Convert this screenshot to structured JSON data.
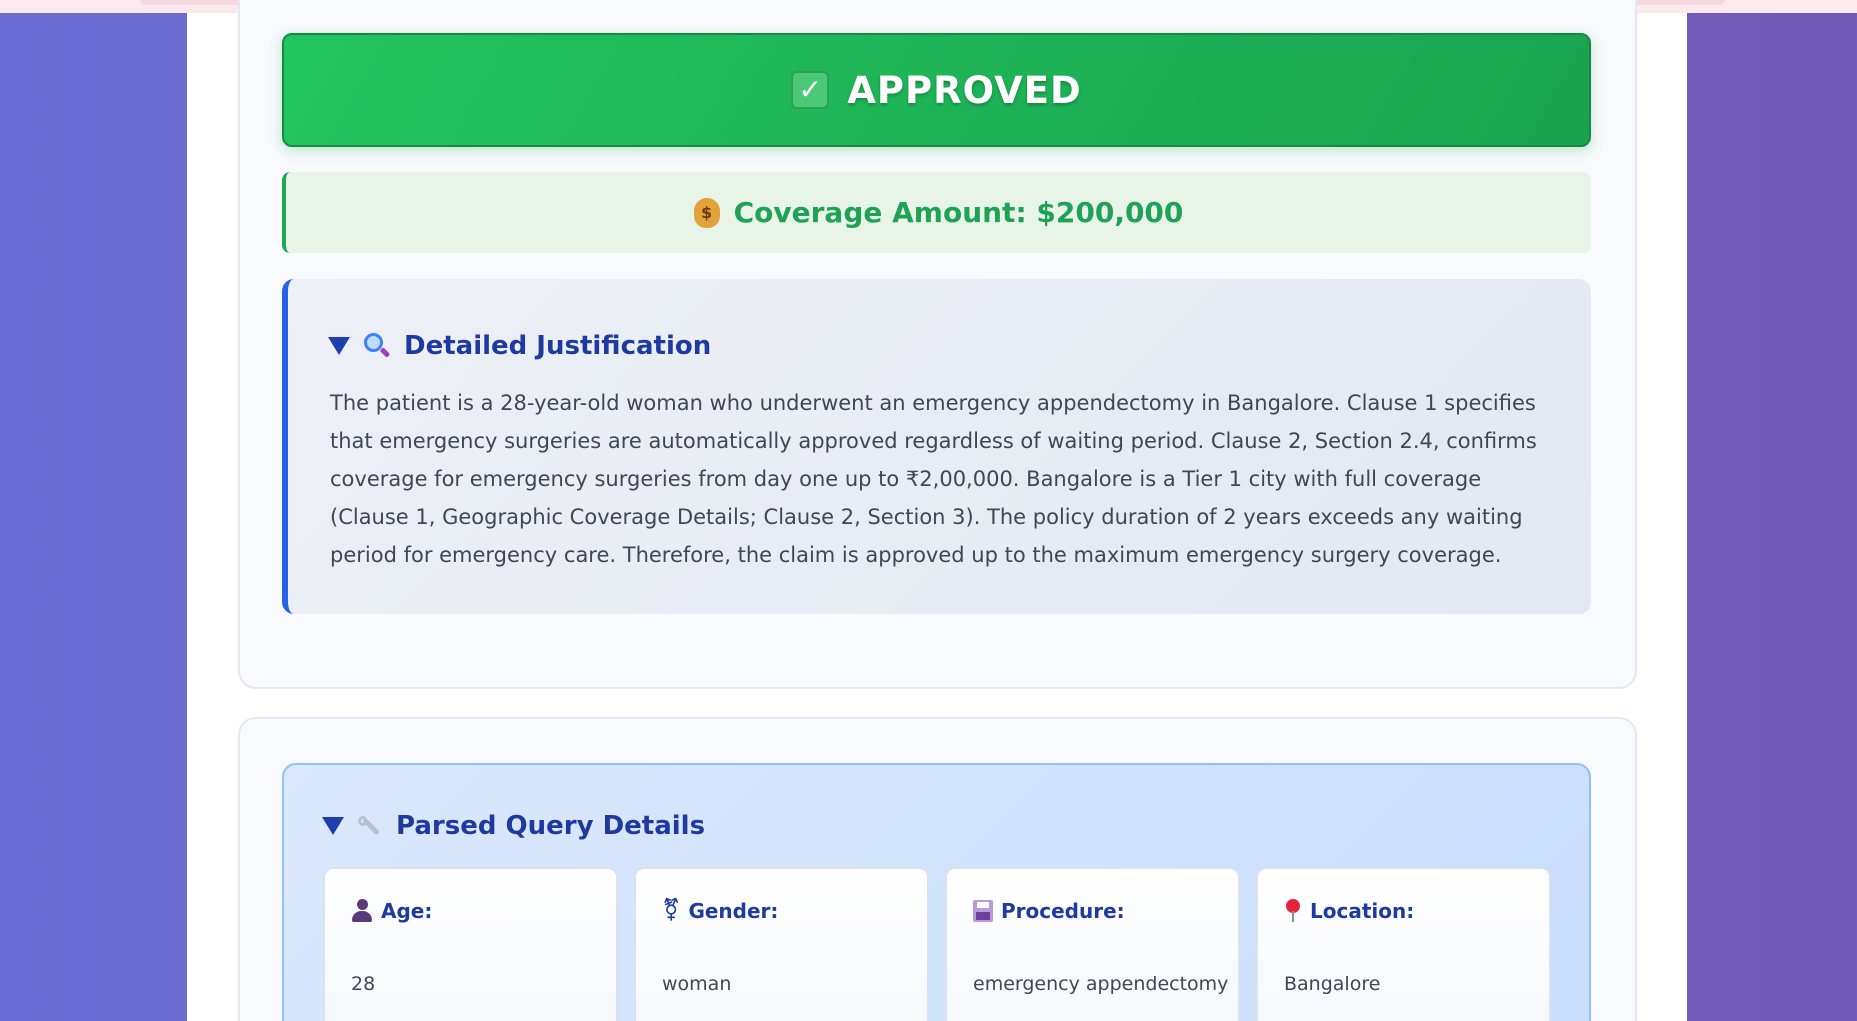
{
  "decision": {
    "status": "APPROVED",
    "icon": "check-box-icon",
    "color": "#22c55e"
  },
  "coverage": {
    "text": "Coverage Amount: $200,000",
    "icon": "money-bag-icon",
    "color": "#1fa255"
  },
  "justification": {
    "title": "Detailed Justification",
    "toggle_icon": "triangle-down-icon",
    "icon": "magnifier-icon",
    "body": "The patient is a 28-year-old woman who underwent an emergency appendectomy in Bangalore. Clause 1 specifies that emergency surgeries are automatically approved regardless of waiting period. Clause 2, Section 2.4, confirms coverage for emergency surgeries from day one up to ₹2,00,000. Bangalore is a Tier 1 city with full coverage (Clause 1, Geographic Coverage Details; Clause 2, Section 3). The policy duration of 2 years exceeds any waiting period for emergency care. Therefore, the claim is approved up to the maximum emergency surgery coverage.",
    "accent": "#2563eb"
  },
  "parsed_query": {
    "title": "Parsed Query Details",
    "toggle_icon": "triangle-down-icon",
    "icon": "wrench-icon",
    "fields": [
      {
        "label": "Age:",
        "value": "28",
        "icon": "person-icon"
      },
      {
        "label": "Gender:",
        "value": "woman",
        "icon": "gender-icon"
      },
      {
        "label": "Procedure:",
        "value": "emergency appendectomy",
        "icon": "floppy-disk-icon"
      },
      {
        "label": "Location:",
        "value": "Bangalore",
        "icon": "pin-icon"
      }
    ]
  }
}
